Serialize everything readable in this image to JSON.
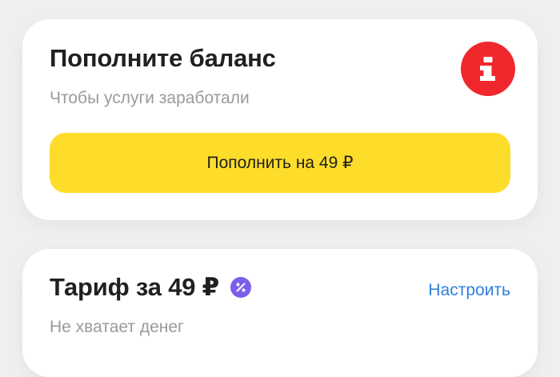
{
  "balance_card": {
    "title": "Пополните баланс",
    "subtitle": "Чтобы услуги заработали",
    "icon": "info-icon",
    "icon_color": "#f0282e",
    "button_label": "Пополнить на 49 ₽",
    "button_color": "#fddd2a"
  },
  "tariff_card": {
    "title": "Тариф за 49 ₽",
    "badge_icon": "percent-icon",
    "badge_color": "#7b5ee8",
    "configure_label": "Настроить",
    "link_color": "#2f7fdc",
    "subtitle": "Не хватает денег"
  }
}
